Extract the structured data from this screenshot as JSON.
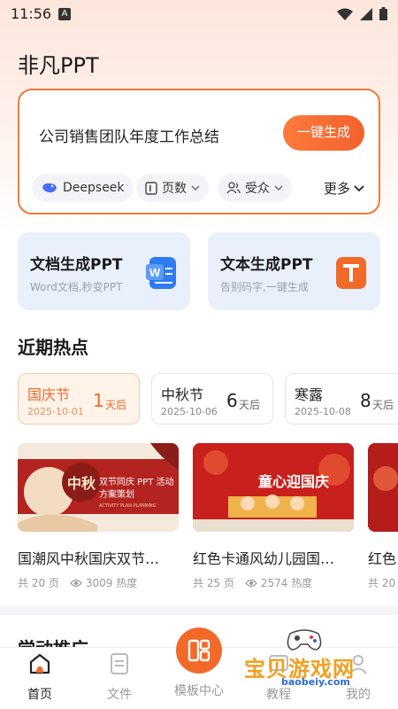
{
  "status": {
    "time": "11:56",
    "notif_letter": "A"
  },
  "app": {
    "title": "非凡PPT"
  },
  "input_card": {
    "text": "公司销售团队年度工作总结",
    "generate_label": "一键生成",
    "chips": [
      {
        "label": "Deepseek"
      },
      {
        "label": "页数"
      },
      {
        "label": "受众"
      }
    ],
    "more_label": "更多"
  },
  "features": [
    {
      "title": "文档生成PPT",
      "sub": "Word文档,秒变PPT",
      "icon": "word-doc-icon",
      "color": "#2f7bf0"
    },
    {
      "title": "文本生成PPT",
      "sub": "告别码字,一键生成",
      "icon": "text-t-icon",
      "color": "#f26a2a"
    }
  ],
  "hot_section": {
    "title": "近期热点"
  },
  "holidays": [
    {
      "name": "国庆节",
      "date": "2025-10-01",
      "days": "1",
      "unit": "天后"
    },
    {
      "name": "中秋节",
      "date": "2025-10-06",
      "days": "6",
      "unit": "天后"
    },
    {
      "name": "寒露",
      "date": "2025-10-08",
      "days": "8",
      "unit": "天后"
    }
  ],
  "templates": [
    {
      "title": "国潮风中秋国庆双节…",
      "pages": "共 20 页",
      "heat": "3009 热度",
      "thumb_text": "双节同庆 PPT 活动方案策划",
      "thumb_en": "ACTIVITY PLAN PLANNING",
      "thumb_char": "中秋"
    },
    {
      "title": "红色卡通风幼儿园国…",
      "pages": "共 25 页",
      "heat": "2574 热度",
      "thumb_text": "童心迎国庆"
    },
    {
      "title": "红色",
      "pages": "共 20"
    }
  ],
  "next_section": {
    "title": "学动推广"
  },
  "nav": [
    {
      "label": "首页",
      "icon": "home-icon"
    },
    {
      "label": "文件",
      "icon": "file-icon"
    },
    {
      "label": "模板中心",
      "icon": "template-icon"
    },
    {
      "label": "教程",
      "icon": "tutorial-icon"
    },
    {
      "label": "我的",
      "icon": "profile-icon"
    }
  ],
  "watermark": {
    "text": "宝贝游戏网",
    "url": "baobeiy.com"
  },
  "colors": {
    "accent": "#f26a2a",
    "feature_bg": "#eaf0fb"
  }
}
